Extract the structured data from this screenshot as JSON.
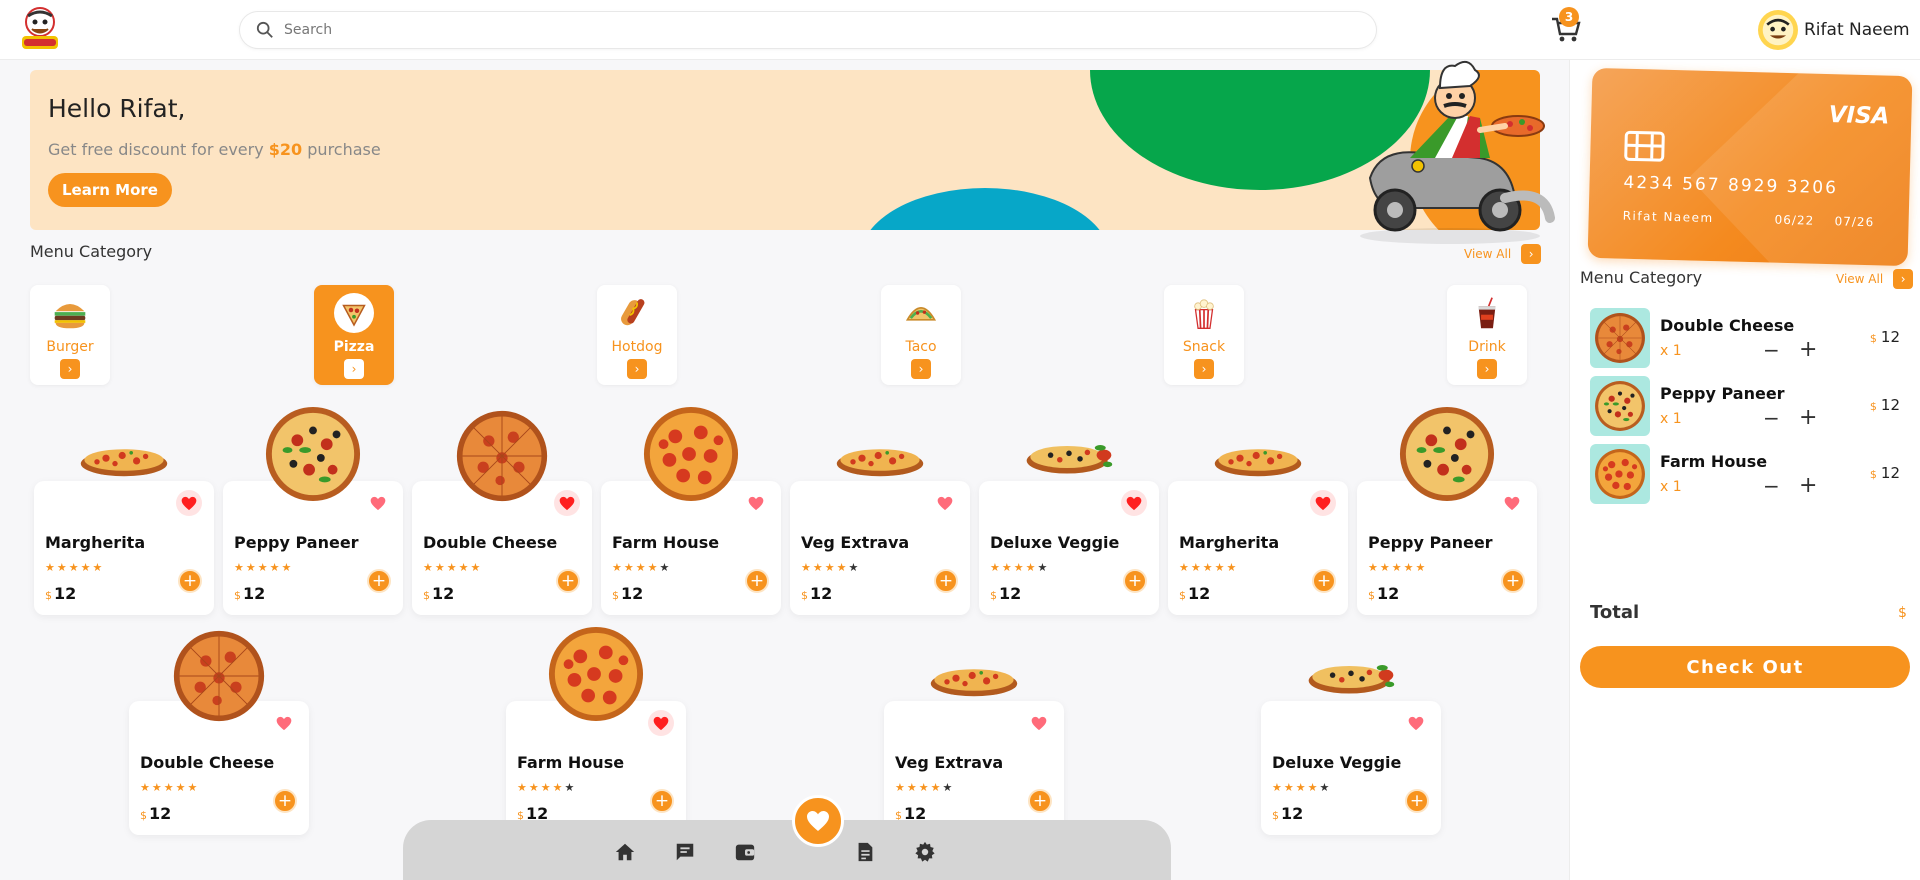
{
  "search": {
    "placeholder": "Search"
  },
  "cart": {
    "count": "3"
  },
  "user": {
    "name": "Rifat Naeem"
  },
  "banner": {
    "greeting": "Hello Rifat,",
    "promo_prefix": "Get free discount for every ",
    "promo_amount": "$20",
    "promo_suffix": " purchase",
    "button": "Learn More"
  },
  "menu_section": {
    "title": "Menu Category",
    "view_all": "View All"
  },
  "categories": [
    {
      "label": "Burger",
      "icon": "burger-icon",
      "active": false
    },
    {
      "label": "Pizza",
      "icon": "pizza-icon",
      "active": true
    },
    {
      "label": "Hotdog",
      "icon": "hotdog-icon",
      "active": false
    },
    {
      "label": "Taco",
      "icon": "taco-icon",
      "active": false
    },
    {
      "label": "Snack",
      "icon": "popcorn-icon",
      "active": false
    },
    {
      "label": "Drink",
      "icon": "drink-icon",
      "active": false
    }
  ],
  "products": [
    {
      "name": "Margherita",
      "stars": 5,
      "currency": "$",
      "price": "12",
      "favorite": true
    },
    {
      "name": "Peppy Paneer",
      "stars": 5,
      "currency": "$",
      "price": "12",
      "favorite": false
    },
    {
      "name": "Double Cheese",
      "stars": 5,
      "currency": "$",
      "price": "12",
      "favorite": true
    },
    {
      "name": "Farm House",
      "stars": 4,
      "currency": "$",
      "price": "12",
      "favorite": false
    },
    {
      "name": "Veg Extrava",
      "stars": 4,
      "currency": "$",
      "price": "12",
      "favorite": false
    },
    {
      "name": "Deluxe Veggie",
      "stars": 4,
      "currency": "$",
      "price": "12",
      "favorite": true
    },
    {
      "name": "Margherita",
      "stars": 5,
      "currency": "$",
      "price": "12",
      "favorite": true
    },
    {
      "name": "Peppy Paneer",
      "stars": 5,
      "currency": "$",
      "price": "12",
      "favorite": false
    },
    {
      "name": "Double Cheese",
      "stars": 5,
      "currency": "$",
      "price": "12",
      "favorite": false
    },
    {
      "name": "Farm House",
      "stars": 4,
      "currency": "$",
      "price": "12",
      "favorite": true
    },
    {
      "name": "Veg Extrava",
      "stars": 4,
      "currency": "$",
      "price": "12",
      "favorite": false
    },
    {
      "name": "Deluxe Veggie",
      "stars": 4,
      "currency": "$",
      "price": "12",
      "favorite": false
    }
  ],
  "bottom_nav": [
    "home-icon",
    "chat-icon",
    "wallet-icon",
    "favorite-icon",
    "document-icon",
    "settings-icon"
  ],
  "card": {
    "brand": "VISA",
    "number": "4234 567 8929 3206",
    "holder": "Rifat Naeem",
    "date1": "06/22",
    "date2": "07/26"
  },
  "order_section": {
    "title": "Menu Category",
    "view_all": "View All"
  },
  "order_items": [
    {
      "name": "Double Cheese",
      "qty": "x 1",
      "currency": "$",
      "price": "12"
    },
    {
      "name": "Peppy Paneer",
      "qty": "x 1",
      "currency": "$",
      "price": "12"
    },
    {
      "name": "Farm House",
      "qty": "x 1",
      "currency": "$",
      "price": "12"
    }
  ],
  "total": {
    "label": "Total",
    "currency": "$"
  },
  "checkout": {
    "label": "Check Out"
  },
  "colors": {
    "accent": "#f7931e",
    "banner_bg": "#fde4c3",
    "favorite_red": "#ff1f1f",
    "favorite_soft": "#ff6b7a"
  }
}
